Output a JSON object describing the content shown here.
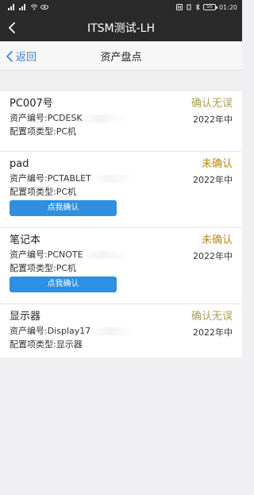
{
  "status_bar": {
    "time": "01:20",
    "battery": "50",
    "left_text": "ill ill"
  },
  "app_bar": {
    "title": "ITSM测试-LH"
  },
  "nav": {
    "back_label": "返回",
    "title": "资产盘点"
  },
  "assets": [
    {
      "name": "PC007号",
      "status": "确认无误",
      "status_type": "confirmed",
      "asset_no_prefix": "资产编号:PCDESK",
      "date": "2022年中",
      "type_line": "配置项类型:PC机",
      "button": ""
    },
    {
      "name": "pad",
      "status": "未确认",
      "status_type": "unconfirmed",
      "asset_no_prefix": "资产编号:PCTABLET",
      "date": "2022年中",
      "type_line": "配置项类型:PC机",
      "button": "点我确认"
    },
    {
      "name": "笔记本",
      "status": "未确认",
      "status_type": "unconfirmed",
      "asset_no_prefix": "资产编号:PCNOTE",
      "date": "2022年中",
      "type_line": "配置项类型:PC机",
      "button": "点我确认"
    },
    {
      "name": "显示器",
      "status": "确认无误",
      "status_type": "confirmed",
      "asset_no_prefix": "资产编号:Display17",
      "date": "2022年中",
      "type_line": "配置项类型:显示器",
      "button": ""
    }
  ],
  "colors": {
    "app_bar_bg": "#2a2a2a",
    "link_blue": "#2f84d8",
    "button_blue": "#2f90e0",
    "confirmed": "#a6a24e",
    "unconfirmed": "#b88a1a"
  }
}
